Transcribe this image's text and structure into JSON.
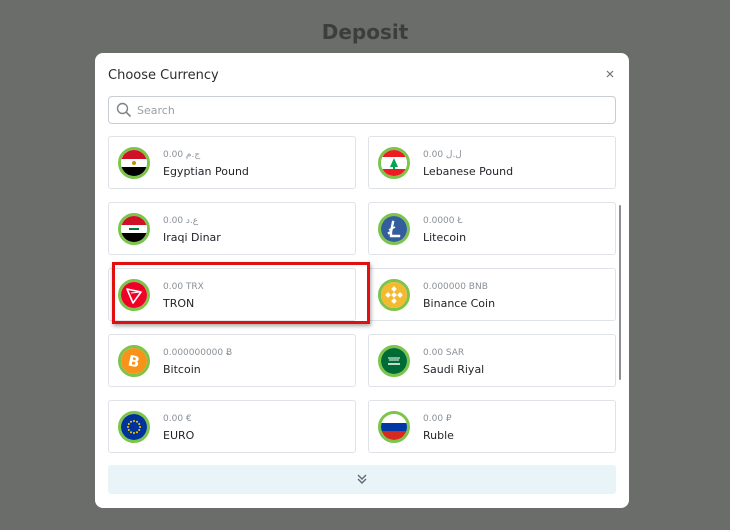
{
  "page": {
    "title": "Deposit"
  },
  "modal": {
    "title": "Choose Currency",
    "search_placeholder": "Search"
  },
  "colors": {
    "overlay": "#6b6d6b",
    "coin_ring": "#7cc44a",
    "highlight": "#e01010",
    "more_button_bg": "#e9f4f8"
  },
  "currencies": [
    {
      "amount": "0.00 ج.م",
      "name": "Egyptian Pound",
      "icon": "egypt-flag-icon",
      "highlighted": false
    },
    {
      "amount": "0.00 ل.ل",
      "name": "Lebanese Pound",
      "icon": "lebanon-flag-icon",
      "highlighted": false
    },
    {
      "amount": "0.00 ع.د",
      "name": "Iraqi Dinar",
      "icon": "iraq-flag-icon",
      "highlighted": false
    },
    {
      "amount": "0.0000 Ł",
      "name": "Litecoin",
      "icon": "litecoin-icon",
      "highlighted": false
    },
    {
      "amount": "0.00 TRX",
      "name": "TRON",
      "icon": "tron-icon",
      "highlighted": true
    },
    {
      "amount": "0.000000 BNB",
      "name": "Binance Coin",
      "icon": "binance-coin-icon",
      "highlighted": false
    },
    {
      "amount": "0.000000000 Ƀ",
      "name": "Bitcoin",
      "icon": "bitcoin-icon",
      "highlighted": false
    },
    {
      "amount": "0.00 SAR",
      "name": "Saudi Riyal",
      "icon": "saudi-flag-icon",
      "highlighted": false
    },
    {
      "amount": "0.00 €",
      "name": "EURO",
      "icon": "eu-flag-icon",
      "highlighted": false
    },
    {
      "amount": "0.00 ₽",
      "name": "Ruble",
      "icon": "russia-flag-icon",
      "highlighted": false
    }
  ],
  "load_more_icon": "double-chevron-down-icon"
}
